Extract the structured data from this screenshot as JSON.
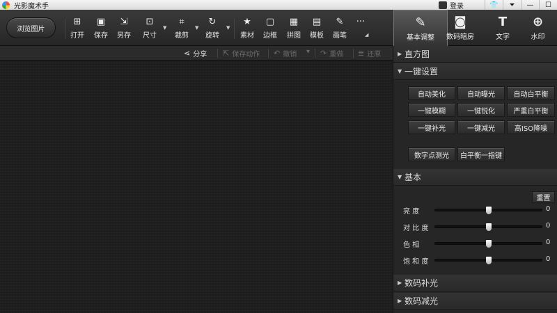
{
  "app": {
    "title": "光影魔术手",
    "login_label": "登录",
    "window_controls": [
      "👕",
      "⏷",
      "—",
      "☐"
    ]
  },
  "toolbar": {
    "browse_label": "浏览图片",
    "tools": [
      {
        "label": "打开",
        "icon": "open-image-icon",
        "glyph": "⊞"
      },
      {
        "label": "保存",
        "icon": "save-icon",
        "glyph": "▣"
      },
      {
        "label": "另存",
        "icon": "save-as-icon",
        "glyph": "⇲"
      },
      {
        "label": "尺寸",
        "icon": "resize-icon",
        "glyph": "⊡"
      },
      {
        "label": "裁剪",
        "icon": "crop-icon",
        "glyph": "⌗"
      },
      {
        "label": "旋转",
        "icon": "rotate-icon",
        "glyph": "↻"
      },
      {
        "label": "素材",
        "icon": "material-icon",
        "glyph": "★"
      },
      {
        "label": "边框",
        "icon": "border-icon",
        "glyph": "▢"
      },
      {
        "label": "拼图",
        "icon": "collage-icon",
        "glyph": "▦"
      },
      {
        "label": "模板",
        "icon": "template-icon",
        "glyph": "▤"
      },
      {
        "label": "画笔",
        "icon": "brush-icon",
        "glyph": "✎"
      }
    ],
    "more_glyph": "···"
  },
  "right_tabs": [
    {
      "label": "基本调整",
      "icon": "basic-adjust-icon",
      "glyph": "✎",
      "active": true
    },
    {
      "label": "数码暗房",
      "icon": "darkroom-icon",
      "glyph": "◙",
      "active": false
    },
    {
      "label": "文字",
      "icon": "text-icon",
      "glyph": "T",
      "active": false
    },
    {
      "label": "水印",
      "icon": "watermark-icon",
      "glyph": "⊕",
      "active": false
    }
  ],
  "action_bar": {
    "share": "分享",
    "save_action": "保存动作",
    "undo": "撤销",
    "redo": "重做",
    "restore": "还原"
  },
  "panel": {
    "histogram": "直方图",
    "one_click": "一键设置",
    "one_click_buttons": [
      "自动美化",
      "自动曝光",
      "自动白平衡",
      "一键模糊",
      "一键锐化",
      "严重白平衡",
      "一键补光",
      "一键减光",
      "高ISO降噪"
    ],
    "extra_buttons": [
      "数字点测光",
      "白平衡一指键"
    ],
    "basic": "基本",
    "reset": "重置",
    "sliders": [
      {
        "label": "亮  度",
        "value": "0",
        "level": 0.5
      },
      {
        "label": "对 比 度",
        "value": "0",
        "level": 0.5
      },
      {
        "label": "色  相",
        "value": "0",
        "level": 0.5
      },
      {
        "label": "饱 和 度",
        "value": "0",
        "level": 0.5
      }
    ],
    "digital_fill": "数码补光",
    "digital_reduce": "数码减光"
  },
  "colors": {
    "canvas_bg": "#1d1d1d",
    "panel_bg": "#262626",
    "toolbar_bg": "#2e2e2e"
  }
}
